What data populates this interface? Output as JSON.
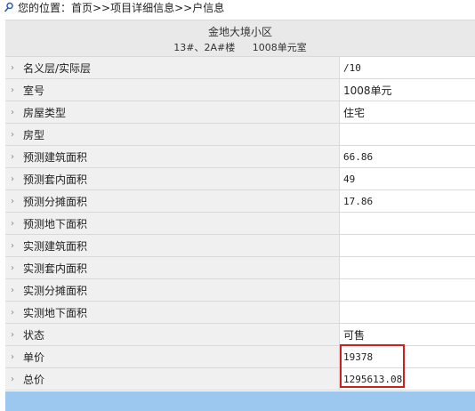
{
  "breadcrumb": {
    "icon": "location-pin-icon",
    "text": "您的位置：首页>>项目详细信息>>户信息"
  },
  "header": {
    "project_name": "金地大境小区",
    "building": "13#、2A#楼",
    "room": "1008单元室"
  },
  "rows": [
    {
      "label": "名义层/实际层",
      "value": "/10"
    },
    {
      "label": "室号",
      "value": "1008单元"
    },
    {
      "label": "房屋类型",
      "value": "住宅"
    },
    {
      "label": "房型",
      "value": ""
    },
    {
      "label": "预测建筑面积",
      "value": "66.86"
    },
    {
      "label": "预测套内面积",
      "value": "49"
    },
    {
      "label": "预测分摊面积",
      "value": "17.86"
    },
    {
      "label": "预测地下面积",
      "value": ""
    },
    {
      "label": "实测建筑面积",
      "value": ""
    },
    {
      "label": "实测套内面积",
      "value": ""
    },
    {
      "label": "实测分摊面积",
      "value": ""
    },
    {
      "label": "实测地下面积",
      "value": ""
    },
    {
      "label": "状态",
      "value": "可售"
    },
    {
      "label": "单价",
      "value": "19378"
    },
    {
      "label": "总价",
      "value": "1295613.08"
    }
  ],
  "colors": {
    "label_bg": "#f0f0f0",
    "header_bg": "#e9e9e9",
    "highlight_border": "#d0201d",
    "bottom_bar": "#9cc7ee"
  }
}
